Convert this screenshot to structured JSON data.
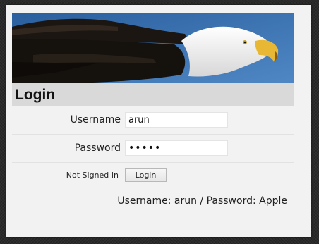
{
  "banner": {
    "image": "bald-eagle-photo",
    "sky_color": "#3b74b5"
  },
  "login": {
    "title": "Login",
    "username_label": "Username",
    "username_value": "arun",
    "password_label": "Password",
    "password_value": "•••••",
    "status_text": "Not Signed In",
    "login_button": "Login",
    "hint_text": "Username: arun / Password: Apple"
  }
}
